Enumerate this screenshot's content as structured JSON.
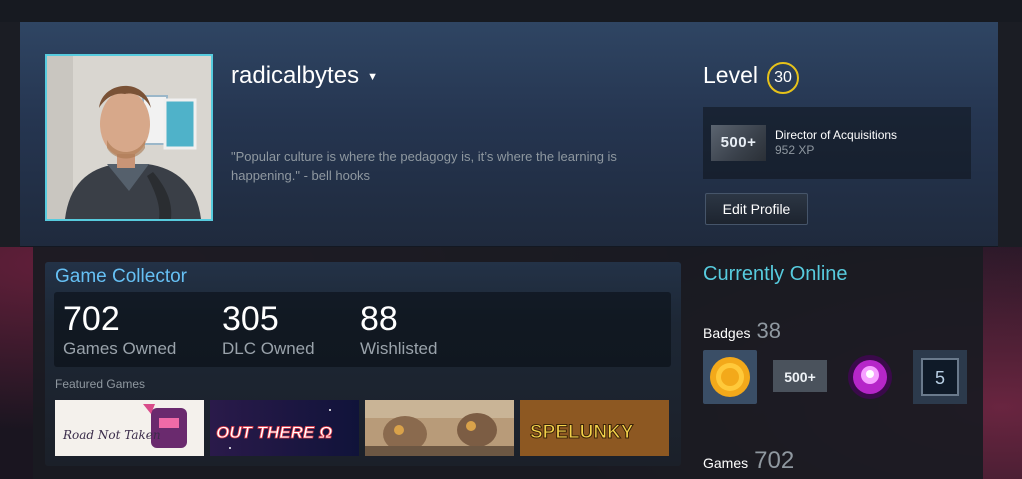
{
  "profile": {
    "username": "radicalbytes",
    "quote": "\"Popular culture is where the pedagogy is, it’s where the learning is happening.\" - bell hooks",
    "level_label": "Level",
    "level": "30",
    "featured_badge": {
      "icon_text": "500+",
      "title": "Director of Acquisitions",
      "xp": "952 XP"
    },
    "edit_button": "Edit Profile"
  },
  "showcase": {
    "title": "Game Collector",
    "stats": [
      {
        "value": "702",
        "label": "Games Owned"
      },
      {
        "value": "305",
        "label": "DLC Owned"
      },
      {
        "value": "88",
        "label": "Wishlisted"
      }
    ],
    "featured_label": "Featured Games",
    "featured_games": [
      {
        "art_text": "Road Not Taken"
      },
      {
        "art_text": "OUT THERE Ω"
      },
      {
        "art_text": ""
      },
      {
        "art_text": "SPELUNKY"
      }
    ]
  },
  "sidebar": {
    "status": "Currently Online",
    "badges_label": "Badges",
    "badges_count": "38",
    "badges": [
      {
        "icon": "gold-coin-badge-icon"
      },
      {
        "icon": "500-plus-badge-icon",
        "text": "500+"
      },
      {
        "icon": "purple-orb-badge-icon"
      },
      {
        "icon": "years-of-service-badge-icon",
        "text": "5"
      }
    ],
    "games_label": "Games",
    "games_count": "702"
  },
  "colors": {
    "accent_blue": "#66c0f4",
    "online_cyan": "#57cbde",
    "level_ring": "#e6c21a"
  }
}
